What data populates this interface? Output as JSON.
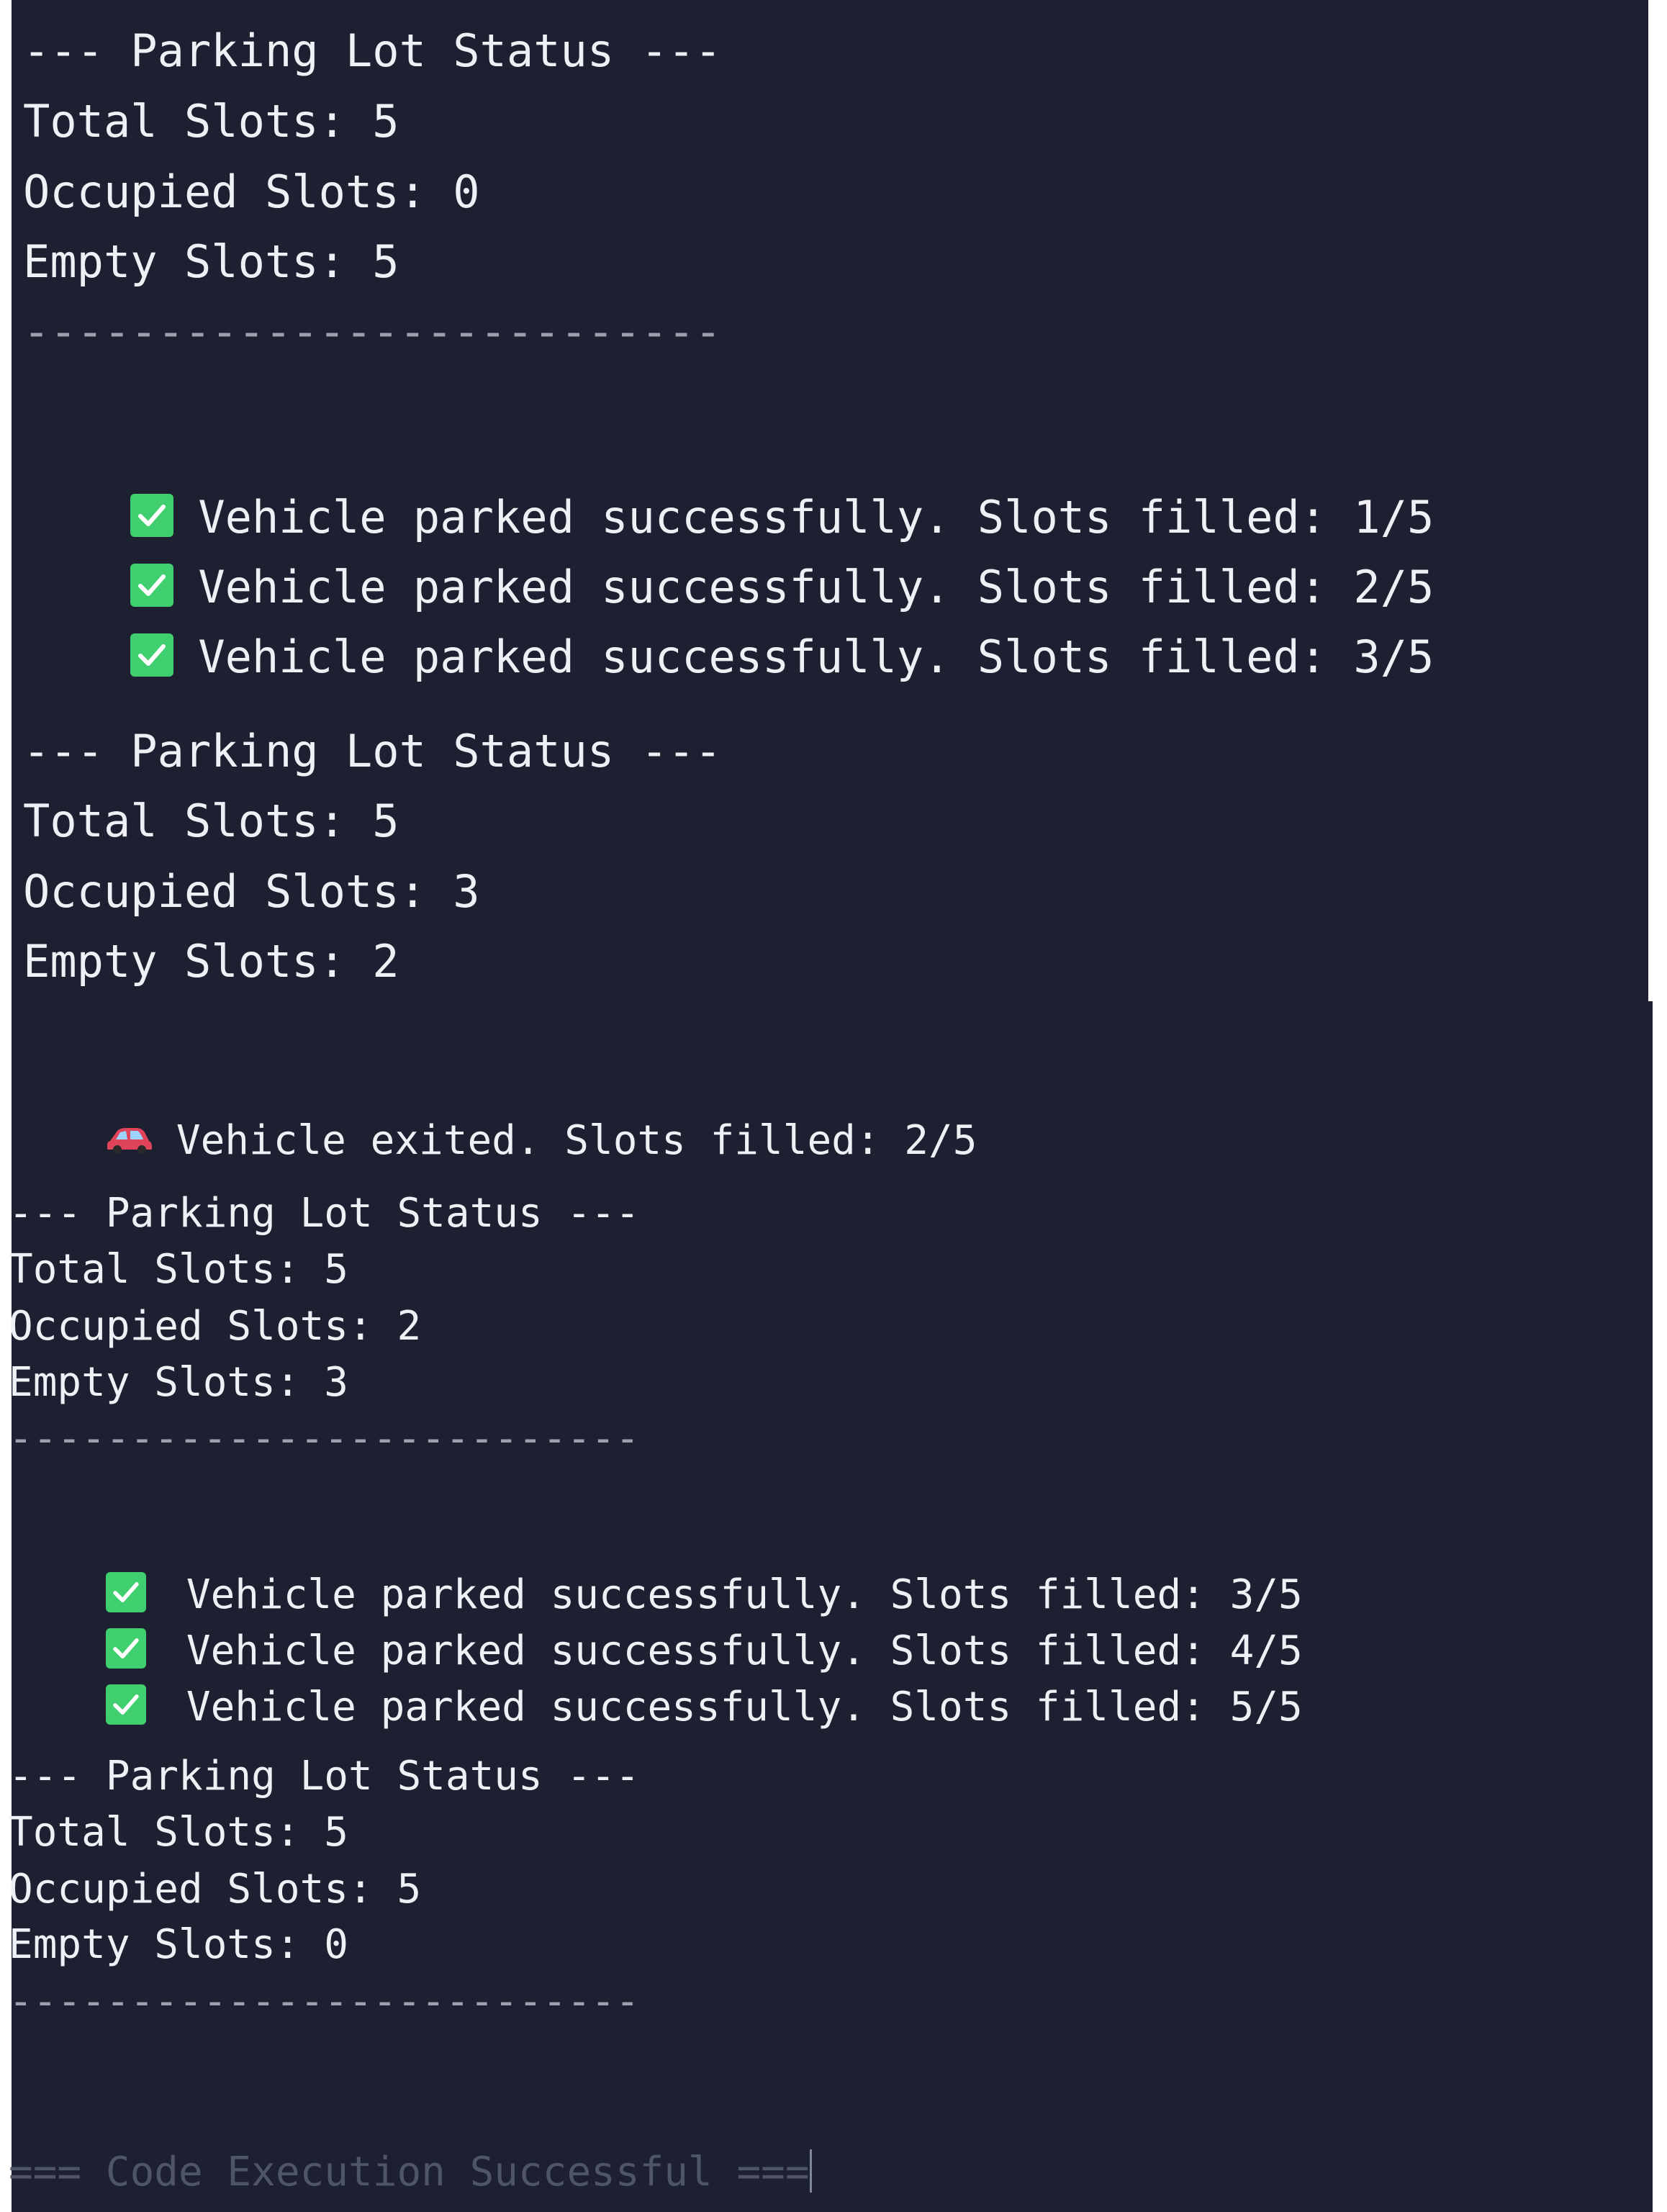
{
  "colors": {
    "terminal_background": "#1c2030",
    "text": "#eef0f6",
    "separator": "#9aa0ad",
    "check_icon": "#3fcf6e",
    "car_icon": "#e0445a",
    "footer_text": "#4e5568"
  },
  "top_panel": {
    "status_1": {
      "header": "--- Parking Lot Status ---",
      "total": "Total Slots: 5",
      "occupied": "Occupied Slots: 0",
      "empty": "Empty Slots: 5",
      "separator": "--------------------------"
    },
    "parked_messages": [
      {
        "icon": "white-check-mark-icon",
        "text": "Vehicle parked successfully. Slots filled: 1/5"
      },
      {
        "icon": "white-check-mark-icon",
        "text": "Vehicle parked successfully. Slots filled: 2/5"
      },
      {
        "icon": "white-check-mark-icon",
        "text": "Vehicle parked successfully. Slots filled: 3/5"
      }
    ],
    "status_2": {
      "header": "--- Parking Lot Status ---",
      "total": "Total Slots: 5",
      "occupied": "Occupied Slots: 3",
      "empty": "Empty Slots: 2"
    }
  },
  "bottom_panel": {
    "exit_message": {
      "icon": "car-icon",
      "text": "Vehicle exited. Slots filled: 2/5"
    },
    "status_3": {
      "header": "--- Parking Lot Status ---",
      "total": "Total Slots: 5",
      "occupied": "Occupied Slots: 2",
      "empty": "Empty Slots: 3",
      "separator": "--------------------------"
    },
    "parked_messages": [
      {
        "icon": "white-check-mark-icon",
        "text": "Vehicle parked successfully. Slots filled: 3/5"
      },
      {
        "icon": "white-check-mark-icon",
        "text": "Vehicle parked successfully. Slots filled: 4/5"
      },
      {
        "icon": "white-check-mark-icon",
        "text": "Vehicle parked successfully. Slots filled: 5/5"
      }
    ],
    "status_4": {
      "header": "--- Parking Lot Status ---",
      "total": "Total Slots: 5",
      "occupied": "Occupied Slots: 5",
      "empty": "Empty Slots: 0",
      "separator": "--------------------------"
    },
    "footer": "=== Code Execution Successful ==="
  }
}
